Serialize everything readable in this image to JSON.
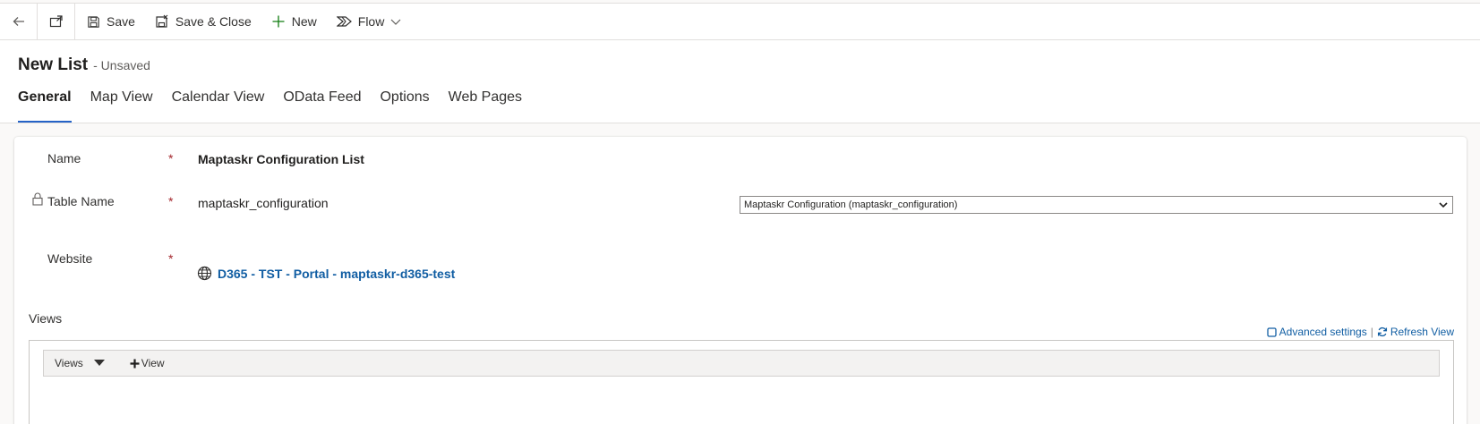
{
  "toolbar": {
    "back_icon": "back-arrow-icon",
    "popout_icon": "popout-icon",
    "save_label": "Save",
    "save_close_label": "Save & Close",
    "new_label": "New",
    "flow_label": "Flow"
  },
  "header": {
    "title": "New List",
    "status": "- Unsaved",
    "tabs": [
      {
        "label": "General",
        "active": true
      },
      {
        "label": "Map View"
      },
      {
        "label": "Calendar View"
      },
      {
        "label": "OData Feed"
      },
      {
        "label": "Options"
      },
      {
        "label": "Web Pages"
      }
    ]
  },
  "form": {
    "name_label": "Name",
    "name_value": "Maptaskr Configuration List",
    "table_label": "Table Name",
    "table_value": "maptaskr_configuration",
    "table_select": "Maptaskr Configuration (maptaskr_configuration)",
    "website_label": "Website",
    "website_value": "D365 - TST - Portal - maptaskr-d365-test",
    "required_mark": "*"
  },
  "views": {
    "label": "Views",
    "advanced_settings": "Advanced settings",
    "separator": "|",
    "refresh_view": "Refresh View",
    "dropdown_label": "Views",
    "add_view_label": "View"
  },
  "colors": {
    "accent": "#2563c7",
    "link": "#115ea3",
    "required": "#a4262c"
  }
}
